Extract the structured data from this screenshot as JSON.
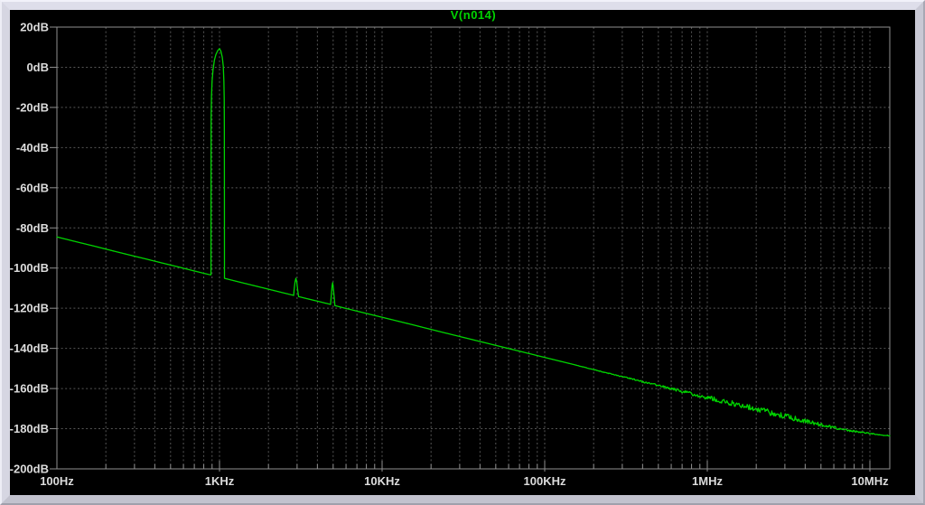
{
  "window": {
    "background": "#000000",
    "bevel_face": "#d4d4e0",
    "bevel_highlight": "#f2f2fa",
    "bevel_shadow": "#a8a8b4"
  },
  "chart_data": {
    "type": "line",
    "title": "V(n014)",
    "x_scale": "log",
    "x_unit": "Hz",
    "y_unit": "dB",
    "x_range_hz": [
      100,
      13250000
    ],
    "y_range_db": [
      -200,
      20
    ],
    "y_tick_step_db": 20,
    "grid": "dotted",
    "legend_position": "top-center",
    "colors": {
      "trace": "#00d400",
      "title": "#00d400",
      "grid": "#565656",
      "axis": "#909090",
      "tick_label": "#dcdcdc",
      "background": "#000000"
    },
    "y_ticks": [
      {
        "db": 20,
        "label": "20dB"
      },
      {
        "db": 0,
        "label": "0dB"
      },
      {
        "db": -20,
        "label": "-20dB"
      },
      {
        "db": -40,
        "label": "-40dB"
      },
      {
        "db": -60,
        "label": "-60dB"
      },
      {
        "db": -80,
        "label": "-80dB"
      },
      {
        "db": -100,
        "label": "-100dB"
      },
      {
        "db": -120,
        "label": "-120dB"
      },
      {
        "db": -140,
        "label": "-140dB"
      },
      {
        "db": -160,
        "label": "-160dB"
      },
      {
        "db": -180,
        "label": "-180dB"
      },
      {
        "db": -200,
        "label": "-200dB"
      }
    ],
    "x_ticks": [
      {
        "hz": 100,
        "label": "100Hz"
      },
      {
        "hz": 1000,
        "label": "1KHz"
      },
      {
        "hz": 10000,
        "label": "10KHz"
      },
      {
        "hz": 100000,
        "label": "100KHz"
      },
      {
        "hz": 1000000,
        "label": "1MHz"
      },
      {
        "hz": 10000000,
        "label": "10MHz"
      }
    ],
    "series": [
      {
        "name": "V(n014)",
        "color": "#00d400",
        "peaks": [
          {
            "hz": 1000,
            "db": 9.3,
            "note": "fundamental"
          },
          {
            "hz": 2950,
            "db": -105.1,
            "note": "3rd harmonic"
          },
          {
            "hz": 4965,
            "db": -107.3,
            "note": "5th harmonic"
          }
        ],
        "points_hz_db": [
          [
            100,
            -84.5
          ],
          [
            130,
            -86.8
          ],
          [
            170,
            -89.1
          ],
          [
            220,
            -91.4
          ],
          [
            280,
            -93.5
          ],
          [
            350,
            -95.4
          ],
          [
            440,
            -97.4
          ],
          [
            550,
            -99.3
          ],
          [
            680,
            -101.2
          ],
          [
            800,
            -102.6
          ],
          [
            860,
            -103.2
          ],
          [
            886,
            -103.4
          ],
          [
            887,
            -50
          ],
          [
            888,
            -25
          ],
          [
            893,
            -14
          ],
          [
            900,
            -7
          ],
          [
            912,
            -1.5
          ],
          [
            930,
            3.5
          ],
          [
            950,
            6.3
          ],
          [
            975,
            8.3
          ],
          [
            1000,
            9.3
          ],
          [
            1020,
            8.0
          ],
          [
            1040,
            5.0
          ],
          [
            1055,
            0.5
          ],
          [
            1064,
            -7
          ],
          [
            1069,
            -16
          ],
          [
            1071,
            -30
          ],
          [
            1072,
            -60
          ],
          [
            1073,
            -105.1
          ],
          [
            1300,
            -106.8
          ],
          [
            1800,
            -109.6
          ],
          [
            2400,
            -112.1
          ],
          [
            2860,
            -113.6
          ],
          [
            2875,
            -111
          ],
          [
            2915,
            -106.8
          ],
          [
            2950,
            -105.1
          ],
          [
            2990,
            -107.3
          ],
          [
            3030,
            -111.3
          ],
          [
            3065,
            -114.2
          ],
          [
            3600,
            -115.6
          ],
          [
            4200,
            -116.9
          ],
          [
            4820,
            -118.1
          ],
          [
            4860,
            -114.5
          ],
          [
            4925,
            -108.8
          ],
          [
            4965,
            -107.3
          ],
          [
            5015,
            -110.2
          ],
          [
            5080,
            -114.8
          ],
          [
            5125,
            -118.7
          ],
          [
            6000,
            -120.1
          ],
          [
            8000,
            -122.6
          ],
          [
            10000,
            -124.5
          ],
          [
            15000,
            -128
          ],
          [
            22000,
            -131.4
          ],
          [
            33000,
            -134.9
          ],
          [
            50000,
            -138.5
          ],
          [
            75000,
            -142
          ],
          [
            100000,
            -144.5
          ],
          [
            150000,
            -148
          ],
          [
            220000,
            -151.4
          ],
          [
            320000,
            -154.6
          ],
          [
            460000,
            -157.8
          ],
          [
            650000,
            -160.8
          ],
          [
            1000000,
            -164.5
          ],
          [
            1500000,
            -167.8
          ],
          [
            2000000,
            -170.3
          ],
          [
            2600000,
            -172.5
          ],
          [
            3300000,
            -174.5
          ],
          [
            4200000,
            -176.5
          ],
          [
            5000000,
            -178
          ],
          [
            6000000,
            -179.4
          ],
          [
            7000000,
            -180.5
          ],
          [
            8000000,
            -181.3
          ],
          [
            9000000,
            -181.9
          ],
          [
            10000000,
            -182.4
          ],
          [
            11500000,
            -183
          ],
          [
            13250000,
            -183.5
          ]
        ],
        "noise_fuzz_halfwidth_db": [
          [
            150000,
            0.05
          ],
          [
            300000,
            0.25
          ],
          [
            500000,
            0.5
          ],
          [
            800000,
            0.85
          ],
          [
            1200000,
            1.2
          ],
          [
            2000000,
            1.55
          ],
          [
            3500000,
            1.3
          ],
          [
            5000000,
            0.9
          ],
          [
            7000000,
            0.55
          ],
          [
            9000000,
            0.35
          ],
          [
            13250000,
            0.25
          ]
        ]
      }
    ]
  }
}
